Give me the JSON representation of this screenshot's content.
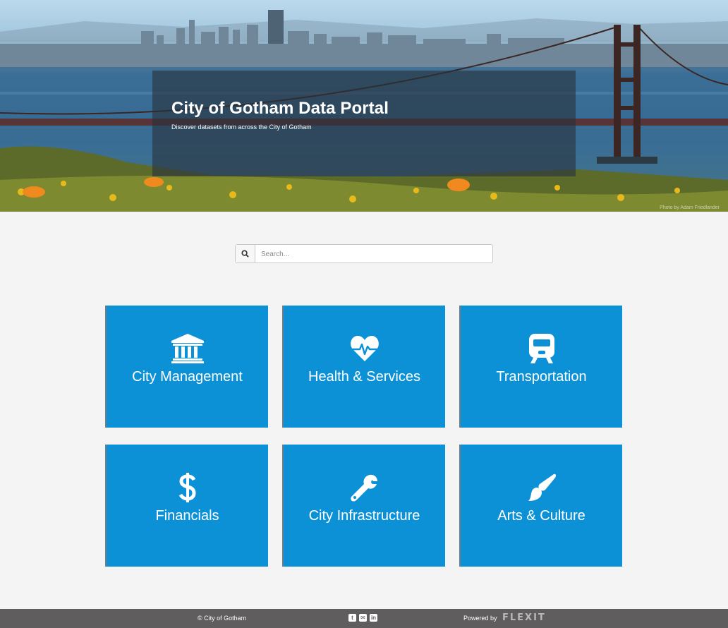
{
  "hero": {
    "title": "City of Gotham Data Portal",
    "subtitle": "Discover datasets from across the City of Gotham",
    "photo_credit": "Photo by Adam Friedlander"
  },
  "search": {
    "placeholder": "Search...",
    "icon": "search-icon"
  },
  "tiles": [
    {
      "label": "City Management",
      "icon": "building-icon"
    },
    {
      "label": "Health & Services",
      "icon": "heartbeat-icon"
    },
    {
      "label": "Transportation",
      "icon": "train-icon"
    },
    {
      "label": "Financials",
      "icon": "dollar-icon"
    },
    {
      "label": "City Infrastructure",
      "icon": "wrench-icon"
    },
    {
      "label": "Arts & Culture",
      "icon": "paintbrush-icon"
    }
  ],
  "colors": {
    "tile_background": "#0d91d6",
    "footer_background": "#5f5d5e",
    "page_background": "#f4f4f4"
  },
  "footer": {
    "copyright": "© City of Gotham",
    "social": [
      {
        "name": "twitter-icon",
        "glyph": "t"
      },
      {
        "name": "email-icon",
        "glyph": "✉"
      },
      {
        "name": "linkedin-icon",
        "glyph": "in"
      }
    ],
    "powered_by": "Powered by",
    "brand": "FLEXIT"
  }
}
